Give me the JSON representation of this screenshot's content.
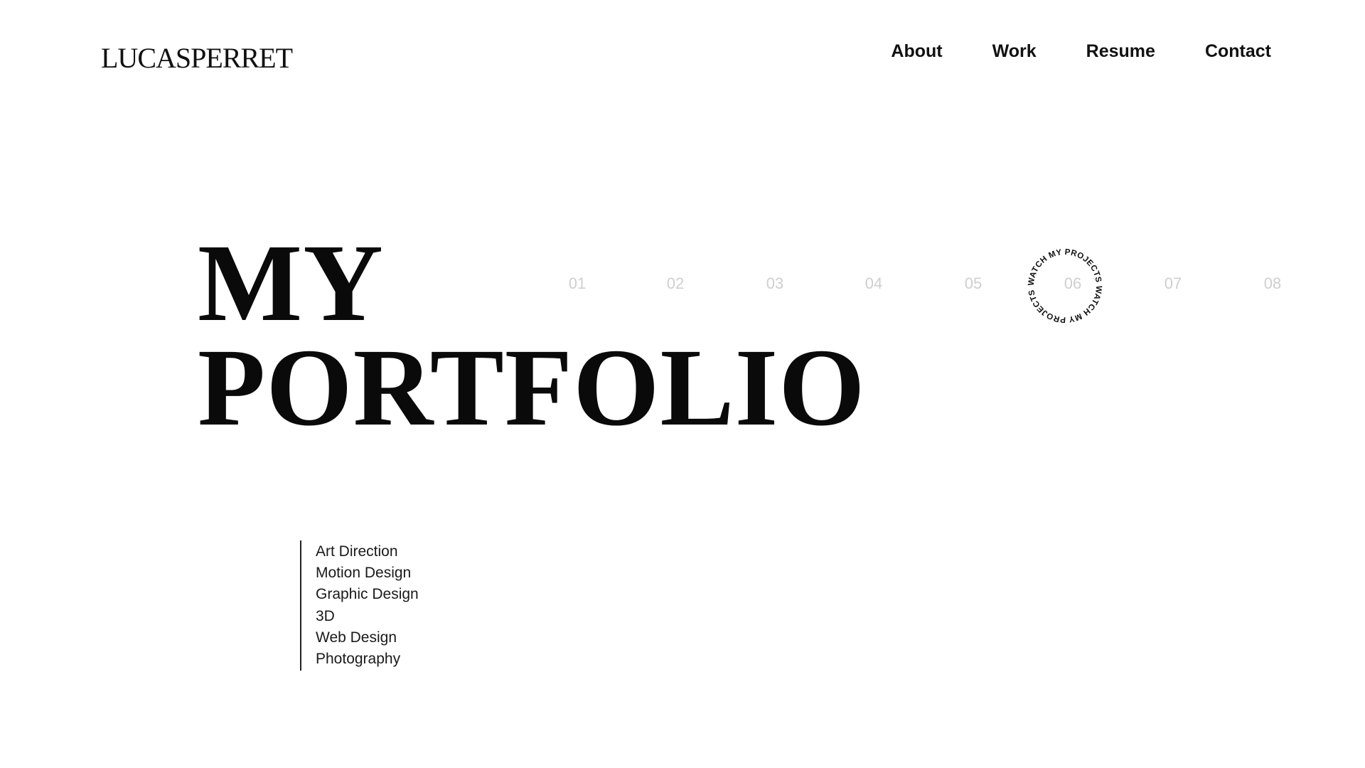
{
  "header": {
    "logo": "LUCASPERRET",
    "nav": [
      {
        "label": "About"
      },
      {
        "label": "Work"
      },
      {
        "label": "Resume"
      },
      {
        "label": "Contact"
      }
    ]
  },
  "hero": {
    "line1": "MY",
    "line2": "PORTFOLIO"
  },
  "projects": {
    "numbers": [
      "01",
      "02",
      "03",
      "04",
      "05",
      "06",
      "07",
      "08"
    ],
    "badge_text": "WATCH MY PROJECTS WATCH MY PROJECTS"
  },
  "services": [
    "Art Direction",
    "Motion Design",
    "Graphic Design",
    "3D",
    "Web Design",
    "Photography"
  ],
  "colors": {
    "text": "#0a0a0a",
    "muted_number": "#cfcfcf",
    "background": "#ffffff"
  }
}
